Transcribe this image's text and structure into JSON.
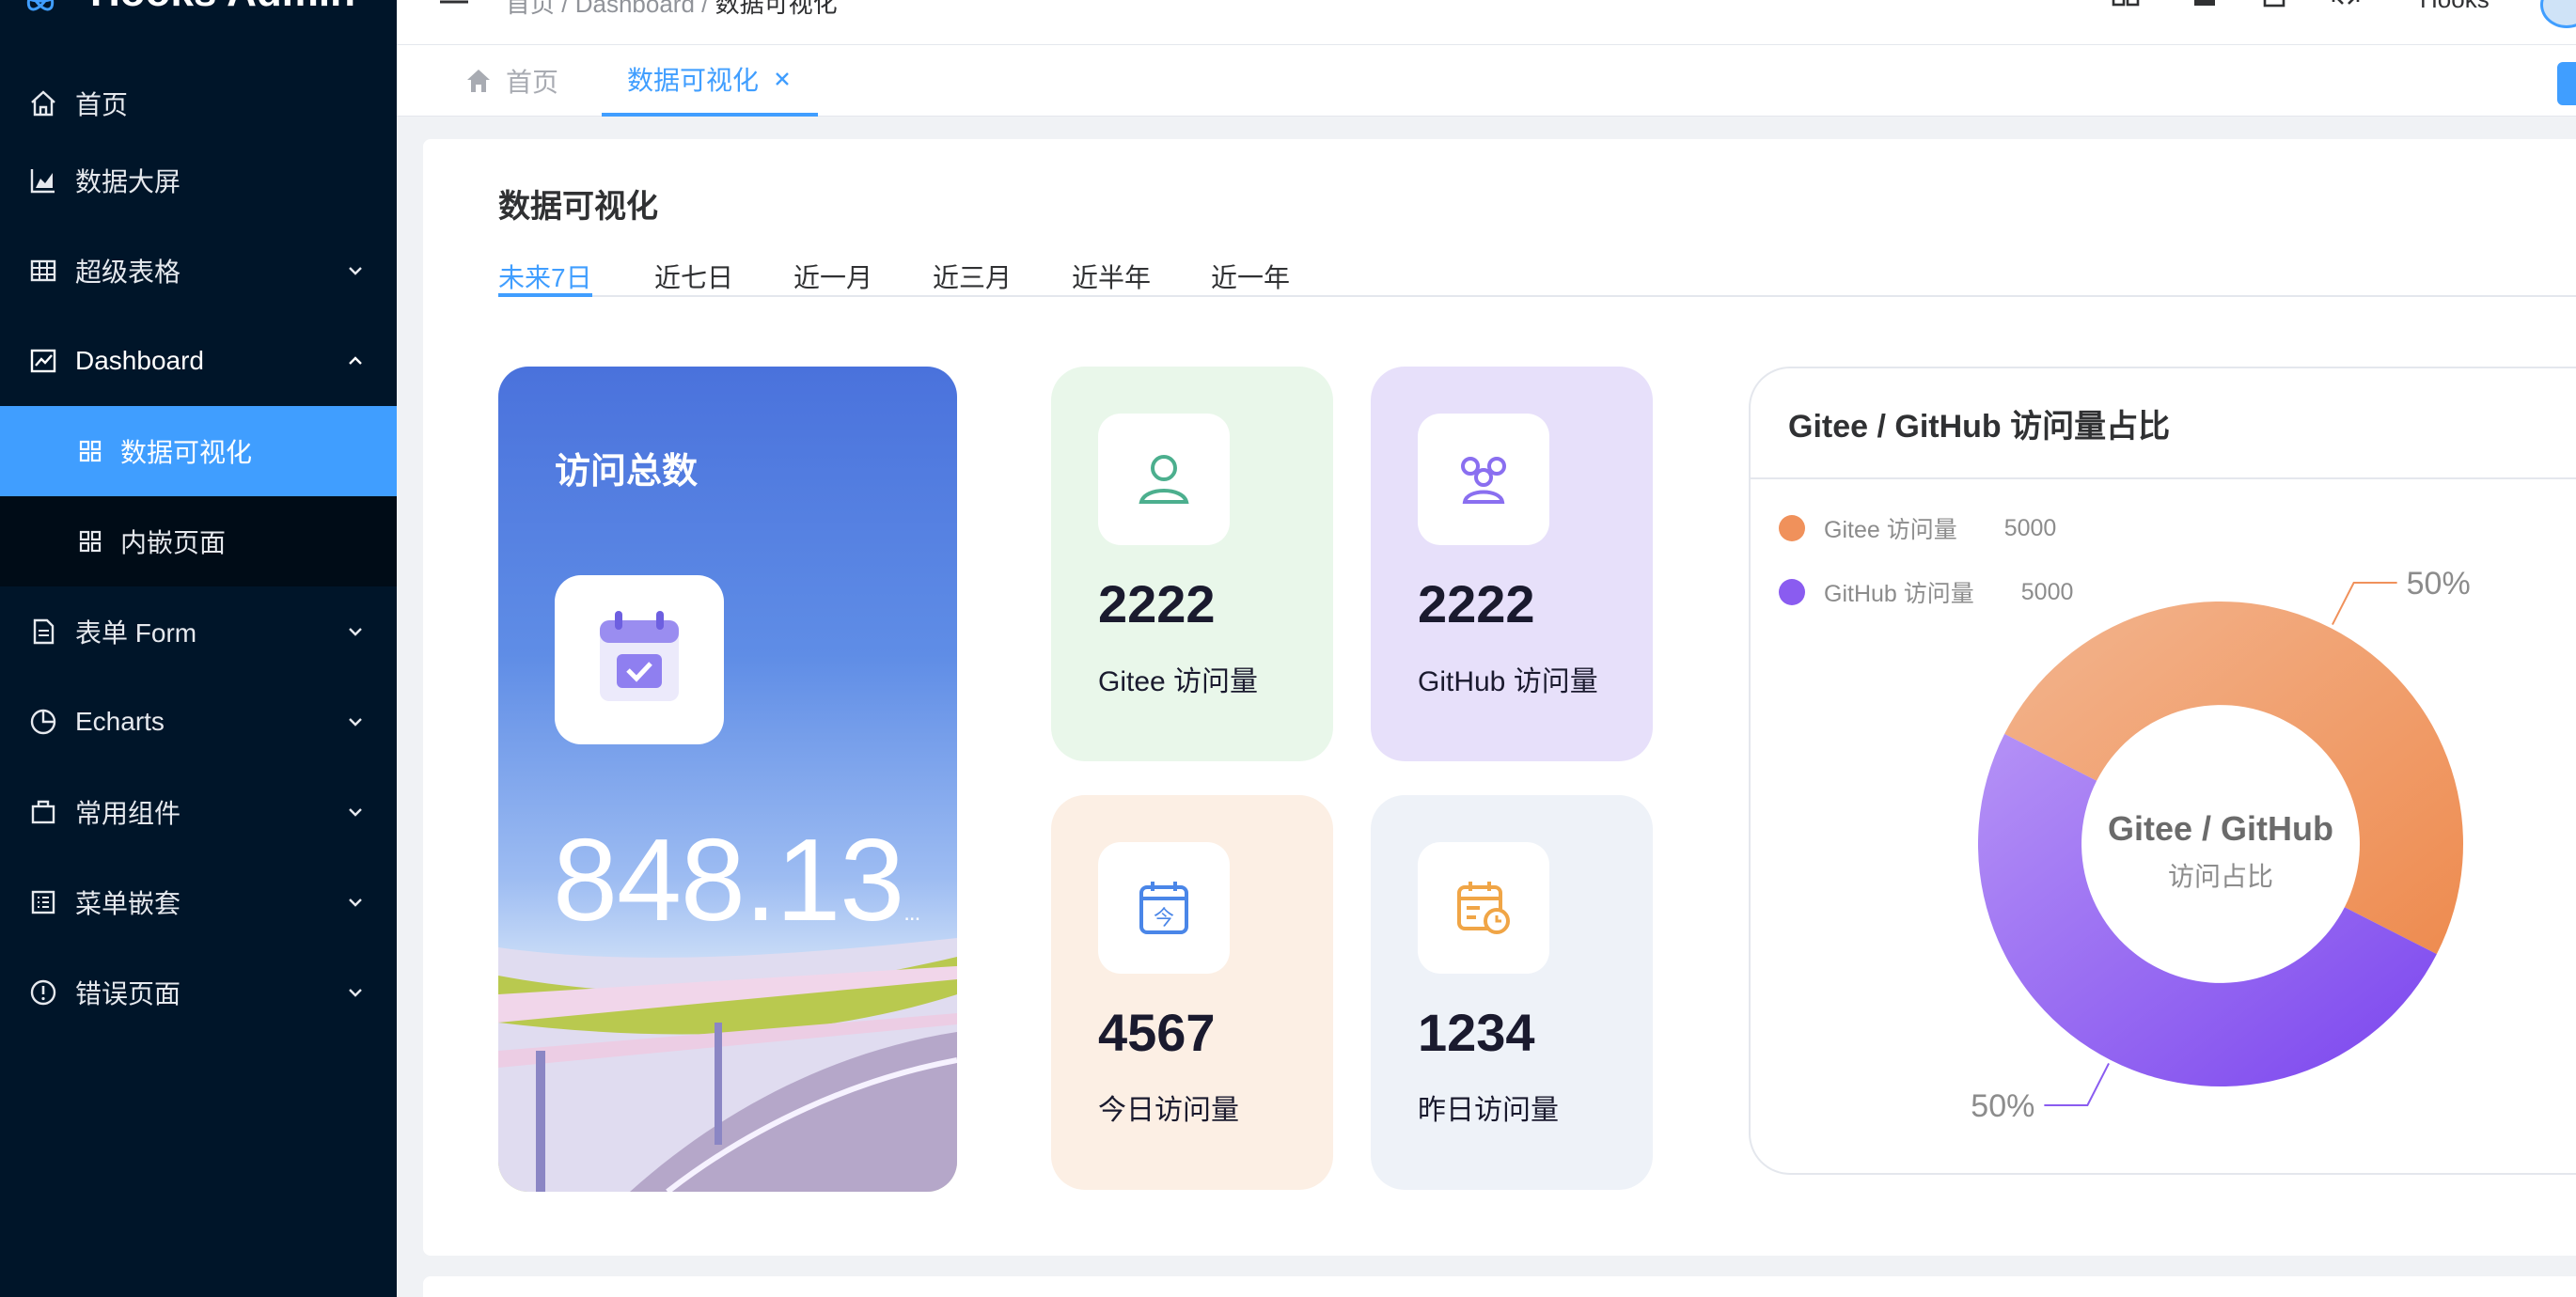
{
  "app": {
    "title": "Hooks Admin"
  },
  "sidebar": {
    "items": [
      {
        "label": "首页"
      },
      {
        "label": "数据大屏"
      },
      {
        "label": "超级表格"
      },
      {
        "label": "Dashboard"
      },
      {
        "label": "数据可视化"
      },
      {
        "label": "内嵌页面"
      },
      {
        "label": "表单 Form"
      },
      {
        "label": "Echarts"
      },
      {
        "label": "常用组件"
      },
      {
        "label": "菜单嵌套"
      },
      {
        "label": "错误页面"
      }
    ]
  },
  "header": {
    "breadcrumb": [
      "首页",
      "Dashboard",
      "数据可视化"
    ],
    "user": "Hooks"
  },
  "tabs": [
    {
      "label": "首页"
    },
    {
      "label": "数据可视化"
    }
  ],
  "page": {
    "title": "数据可视化",
    "ranges": [
      "未来7日",
      "近七日",
      "近一月",
      "近三月",
      "近半年",
      "近一年"
    ],
    "active_range": "未来7日"
  },
  "total": {
    "title": "访问总数",
    "value": "848.13",
    "ellipsis": "..."
  },
  "stats": [
    {
      "value": "2222",
      "label": "Gitee 访问量"
    },
    {
      "value": "2222",
      "label": "GitHub 访问量"
    },
    {
      "value": "4567",
      "label": "今日访问量"
    },
    {
      "value": "1234",
      "label": "昨日访问量"
    }
  ],
  "colors": {
    "sidebar_bg": "#001529",
    "accent": "#409eff",
    "gitee": "#f0915b",
    "github": "#8a5cf0"
  },
  "chart_data": {
    "type": "pie",
    "title": "Gitee / GitHub 访问量占比",
    "center_title": "Gitee / GitHub",
    "center_subtitle": "访问占比",
    "legend_placement": "top-left",
    "series": [
      {
        "name": "Gitee 访问量",
        "value": 5000,
        "percent_label": "50%",
        "color": "#f0915b"
      },
      {
        "name": "GitHub 访问量",
        "value": 5000,
        "percent_label": "50%",
        "color": "#8a5cf0"
      }
    ]
  }
}
